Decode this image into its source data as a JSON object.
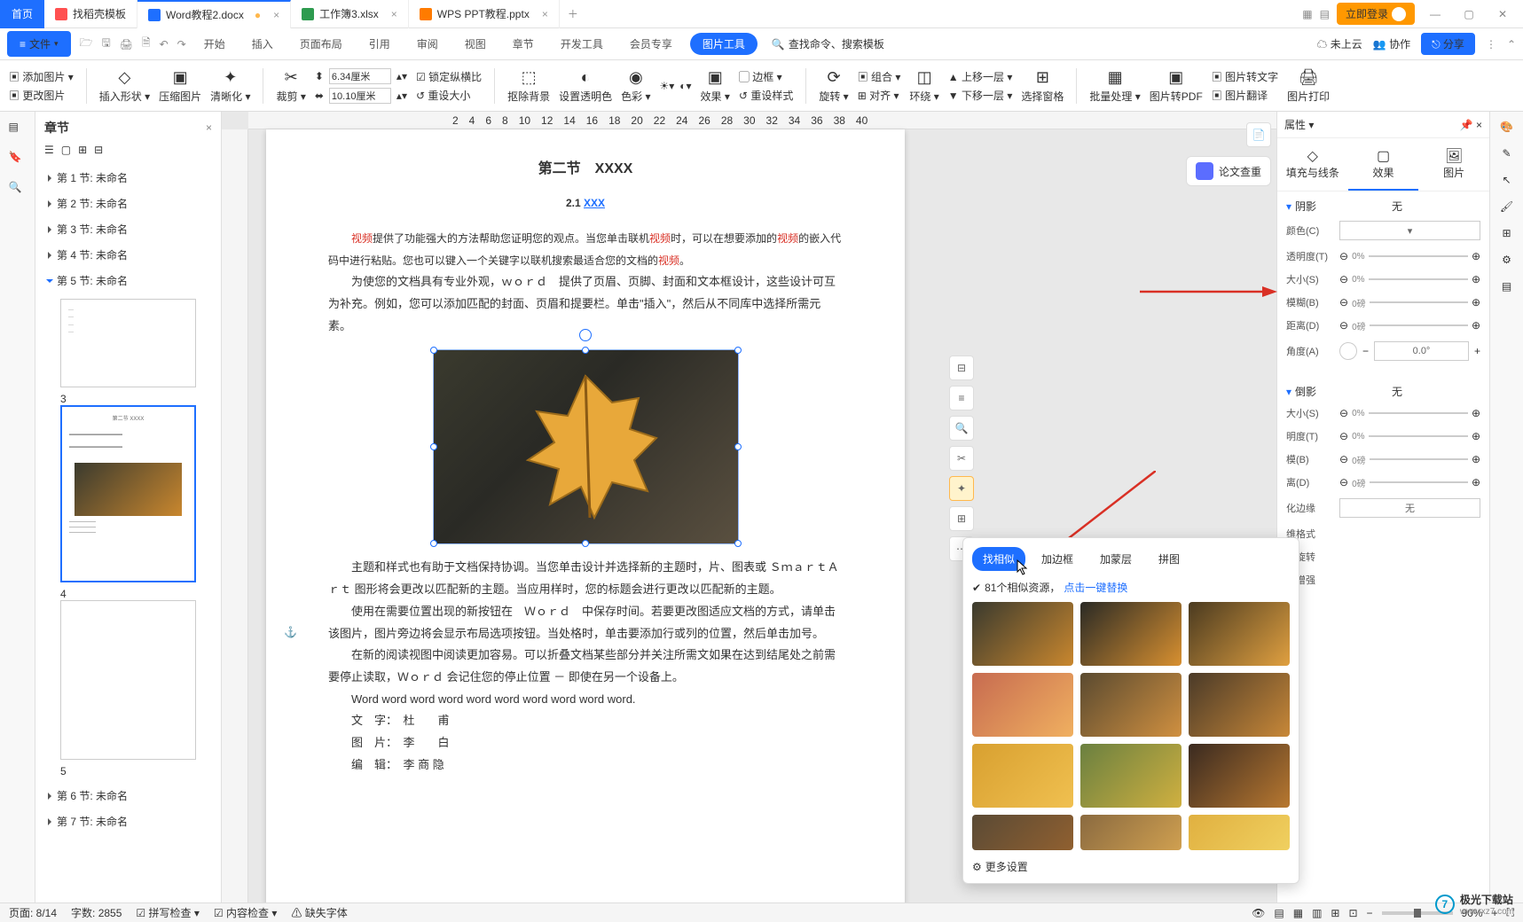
{
  "titlebar": {
    "home": "首页",
    "tabs": [
      {
        "icon": "#ff5050",
        "label": "找稻壳模板"
      },
      {
        "icon": "#1e6fff",
        "label": "Word教程2.docx",
        "active": true,
        "dirty": "●"
      },
      {
        "icon": "#2e9b4f",
        "label": "工作簿3.xlsx"
      },
      {
        "icon": "#ff7b00",
        "label": "WPS PPT教程.pptx"
      }
    ],
    "login": "立即登录"
  },
  "menubar": {
    "file": "文件",
    "items": [
      "开始",
      "插入",
      "页面布局",
      "引用",
      "审阅",
      "视图",
      "章节",
      "开发工具",
      "会员专享"
    ],
    "context": "图片工具",
    "search_ph": "查找命令、搜索模板",
    "cloud": "未上云",
    "coop": "协作",
    "share": "分享"
  },
  "ribbon": {
    "addpic": "添加图片",
    "changepic": "更改图片",
    "insertshape": "插入形状",
    "compress": "压缩图片",
    "clarity": "清晰化",
    "crop": "裁剪",
    "w": "6.34厘米",
    "h": "10.10厘米",
    "lock": "锁定纵横比",
    "reset": "重设大小",
    "removebg": "抠除背景",
    "settrans": "设置透明色",
    "color": "色彩",
    "effect": "效果",
    "resetsty": "重设样式",
    "rotate": "旋转",
    "align": "对齐",
    "wrap": "环绕",
    "border": "边框",
    "group": "组合",
    "up": "上移一层",
    "down": "下移一层",
    "selpane": "选择窗格",
    "batch": "批量处理",
    "pic2pdf": "图片转PDF",
    "pic2txt": "图片转文字",
    "pictrans": "图片翻译",
    "picprint": "图片打印"
  },
  "sidebar": {
    "title": "章节",
    "chapters": [
      "第 1 节: 未命名",
      "第 2 节: 未命名",
      "第 3 节: 未命名",
      "第 4 节: 未命名",
      "第 5 节: 未命名",
      "第 6 节: 未命名",
      "第 7 节: 未命名"
    ],
    "sel_index": 4,
    "thumbs": [
      {
        "n": "3"
      },
      {
        "n": "4",
        "sel": true
      },
      {
        "n": "5"
      }
    ]
  },
  "doc": {
    "heading": "第二节　XXXX",
    "sub_num": "2.1 ",
    "sub_link": "XXX",
    "p1a": "视频",
    "p1b": "提供了功能强大的方法帮助您证明您的观点。当您单击联机",
    "p1c": "视频",
    "p1d": "时，可以在想要添加的",
    "p1e": "视频",
    "p1f": "的嵌入代码中进行粘贴。您也可以键入一个关键字以联机搜索最适合您的文档的",
    "p1g": "视频",
    "p1h": "。",
    "p2": "为使您的文档具有专业外观，ｗｏｒｄ　提供了页眉、页脚、封面和文本框设计，这些设计可互为补充。例如，您可以添加匹配的封面、页眉和提要栏。单击\"插入\"，然后从不同库中选择所需元素。",
    "p3": "主题和样式也有助于文档保持协调。当您单击设计并选择新的主题时，片、图表或 ＳｍａｒｔＡｒｔ 图形将会更改以匹配新的主题。当应用样时，您的标题会进行更改以匹配新的主题。",
    "p4": "使用在需要位置出现的新按钮在　Ｗｏｒｄ　中保存时间。若要更改图适应文档的方式，请单击该图片，图片旁边将会显示布局选项按钮。当处格时，单击要添加行或列的位置，然后单击加号。",
    "p5": "在新的阅读视图中阅读更加容易。可以折叠文档某些部分并关注所需文如果在达到结尾处之前需要停止读取，Ｗｏｒｄ 会记住您的停止位置 － 即使在另一个设备上。",
    "p6": "Word word word word word word word word word word.",
    "l1": "文　字：　杜　　甫",
    "l2": "图　片：　李　　白",
    "l3": "编　辑：　李 商 隐"
  },
  "paperchk": "论文查重",
  "popup": {
    "tabs": [
      "找相似",
      "加边框",
      "加蒙层",
      "拼图"
    ],
    "info": "81个相似资源，",
    "info_link": "点击一键替换",
    "more": "更多设置"
  },
  "rightpanel": {
    "title": "属性",
    "tabs": [
      "填充与线条",
      "效果",
      "图片"
    ],
    "shadow": "阴影",
    "none": "无",
    "color": "颜色(C)",
    "trans": "透明度(T)",
    "size": "大小(S)",
    "blur": "模糊(B)",
    "dist": "距离(D)",
    "angle": "角度(A)",
    "pct": "0%",
    "pt": "0磅",
    "deg": "0.0°",
    "refl": "倒影",
    "r_trans": "明度(T)",
    "r_blur": "模(B)",
    "r_dist": "离(D)",
    "softedge": "化边缘",
    "threed": "维格式",
    "threedrot": "维旋转",
    "fix": "复增强"
  },
  "status": {
    "page": "页面: 8/14",
    "words": "字数: 2855",
    "spell": "拼写检查",
    "content": "内容检查",
    "missfont": "缺失字体",
    "zoom": "90%"
  },
  "watermark": {
    "name": "极光下载站",
    "url": "www.xz7.com"
  }
}
